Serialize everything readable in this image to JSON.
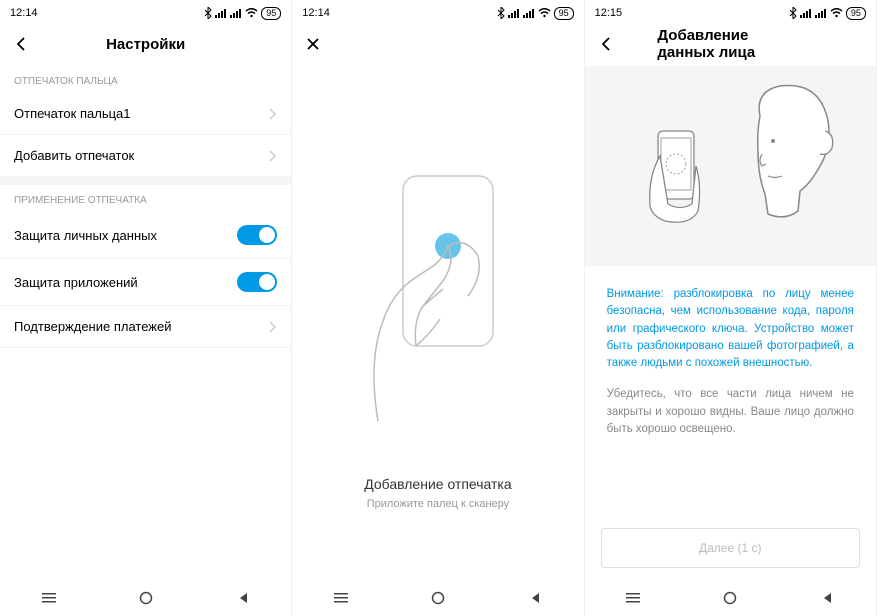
{
  "phone1": {
    "time": "12:14",
    "battery": "95",
    "header_title": "Настройки",
    "section1": "ОТПЕЧАТОК ПАЛЬЦА",
    "item_fp1": "Отпечаток пальца1",
    "item_add": "Добавить отпечаток",
    "section2": "ПРИМЕНЕНИЕ ОТПЕЧАТКА",
    "item_privacy": "Защита личных данных",
    "item_apps": "Защита приложений",
    "item_payments": "Подтверждение платежей"
  },
  "phone2": {
    "time": "12:14",
    "battery": "95",
    "title": "Добавление отпечатка",
    "subtitle": "Приложите палец к сканеру"
  },
  "phone3": {
    "time": "12:15",
    "battery": "95",
    "header_title": "Добавление данных лица",
    "warning": "Внимание: разблокировка по лицу менее безопасна, чем использование кода, пароля или графического ключа. Устройство может быть разблокировано вашей фотографией, а также людьми с похожей внешностью.",
    "instruction": "Убедитесь, что все части лица ничем не закрыты и хорошо видны. Ваше лицо должно быть хорошо освещено.",
    "next": "Далее (1 с)"
  }
}
